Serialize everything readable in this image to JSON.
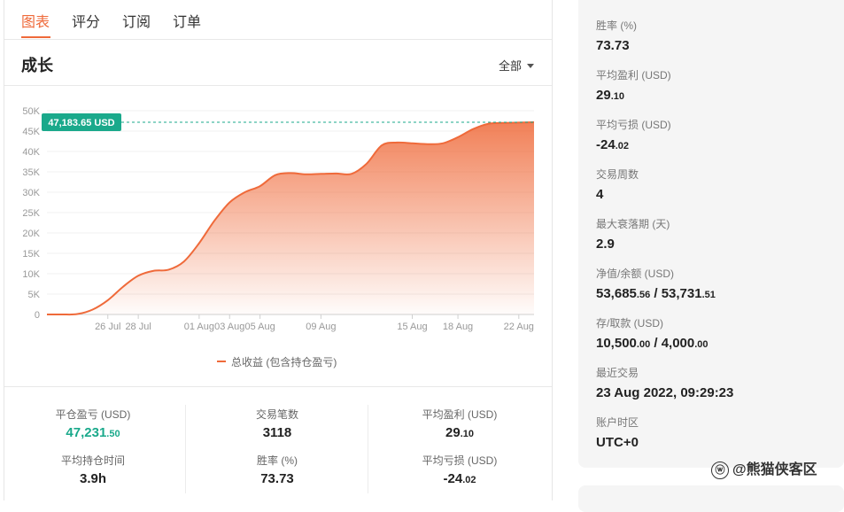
{
  "tabs": [
    "图表",
    "评分",
    "订阅",
    "订单"
  ],
  "section": {
    "title": "成长",
    "filter": "全部"
  },
  "chart_data": {
    "type": "area",
    "x": [
      "21 Jul",
      "22 Jul",
      "24 Jul",
      "25 Jul",
      "26 Jul",
      "27 Jul",
      "28 Jul",
      "29 Jul",
      "30 Jul",
      "31 Jul",
      "01 Aug",
      "02 Aug",
      "03 Aug",
      "04 Aug",
      "05 Aug",
      "06 Aug",
      "07 Aug",
      "08 Aug",
      "09 Aug",
      "10 Aug",
      "11 Aug",
      "12 Aug",
      "13 Aug",
      "14 Aug",
      "15 Aug",
      "16 Aug",
      "17 Aug",
      "18 Aug",
      "19 Aug",
      "20 Aug",
      "21 Aug",
      "22 Aug",
      "23 Aug"
    ],
    "values": [
      0,
      0,
      100,
      1200,
      3500,
      6800,
      9500,
      10700,
      11000,
      13000,
      17500,
      23000,
      27500,
      30000,
      31500,
      34200,
      34700,
      34400,
      34500,
      34600,
      34500,
      37000,
      41500,
      42200,
      42000,
      41800,
      42000,
      43500,
      45500,
      46800,
      47000,
      47100,
      47183.65
    ],
    "series_name": "总收益 (包含持仓盈亏)",
    "ylim": [
      0,
      50000
    ],
    "yticks": [
      "0",
      "5K",
      "10K",
      "15K",
      "20K",
      "25K",
      "30K",
      "35K",
      "40K",
      "45K",
      "50K"
    ],
    "xticks": [
      "26 Jul",
      "28 Jul",
      "01 Aug",
      "03 Aug",
      "05 Aug",
      "09 Aug",
      "15 Aug",
      "18 Aug",
      "22 Aug"
    ],
    "last_label": "47,183.65 USD",
    "grid": true,
    "color": "#ef6a3a",
    "badge_color": "#1aa98b"
  },
  "stats": {
    "closed_pl": {
      "label": "平仓盈亏 (USD)",
      "int": "47,231",
      "dec": ".50"
    },
    "trades": {
      "label": "交易笔数",
      "value": "3118"
    },
    "avg_profit": {
      "label": "平均盈利 (USD)",
      "int": "29",
      "dec": ".10"
    },
    "avg_hold": {
      "label": "平均持仓时间",
      "value": "3.9h"
    },
    "winrate": {
      "label": "胜率 (%)",
      "value": "73.73"
    },
    "avg_loss": {
      "label": "平均亏损 (USD)",
      "int": "-24",
      "dec": ".02"
    }
  },
  "side": {
    "winrate": {
      "k": "胜率 (%)",
      "v": "73.73"
    },
    "avg_profit": {
      "k": "平均盈利 (USD)",
      "int": "29",
      "dec": ".10"
    },
    "avg_loss": {
      "k": "平均亏损 (USD)",
      "int": "-24",
      "dec": ".02"
    },
    "weeks": {
      "k": "交易周数",
      "v": "4"
    },
    "drawdown": {
      "k": "最大衰落期 (天)",
      "v": "2.9"
    },
    "equity": {
      "k": "净值/余额 (USD)",
      "a_int": "53,685",
      "a_dec": ".56",
      "sep": " / ",
      "b_int": "53,731",
      "b_dec": ".51"
    },
    "deposit": {
      "k": "存/取款 (USD)",
      "a_int": "10,500",
      "a_dec": ".00",
      "sep": " / ",
      "b_int": "4,000",
      "b_dec": ".00"
    },
    "last_trade": {
      "k": "最近交易",
      "v": "23 Aug 2022, 09:29:23"
    },
    "tz": {
      "k": "账户时区",
      "v": "UTC+0"
    }
  },
  "watermark": "@熊猫侠客区"
}
